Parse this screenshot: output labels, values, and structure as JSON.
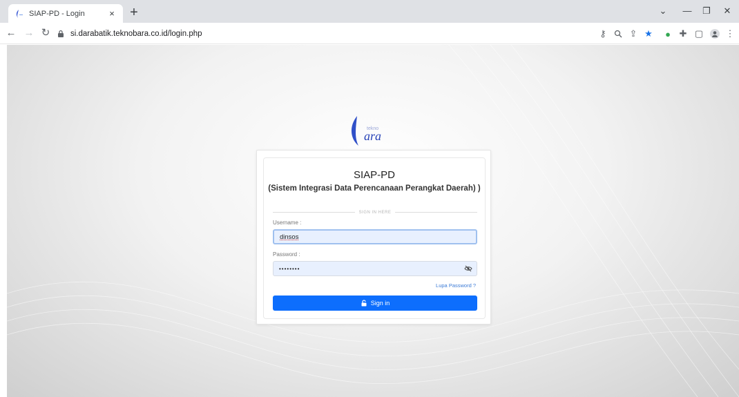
{
  "browser": {
    "tab_title": "SIAP-PD - Login",
    "tab_close": "×",
    "new_tab": "+",
    "url": "si.darabatik.teknobara.co.id/login.php",
    "window_controls": {
      "dropdown": "⌄",
      "minimize": "—",
      "restore": "❐",
      "close": "✕"
    }
  },
  "login": {
    "logo_text": "ara",
    "logo_small": "tekno",
    "title": "SIAP-PD",
    "subtitle": "(Sistem Integrasi Data Perencanaan Perangkat Daerah) )",
    "divider_text": "SIGN IN HERE",
    "username_label": "Username :",
    "username_value": "dinsos",
    "password_label": "Password :",
    "password_value": "••••••••",
    "forgot_password": "Lupa Password ?",
    "signin_label": "Sign in"
  },
  "colors": {
    "primary": "#0d6efd",
    "link": "#3c7bd6",
    "input_bg": "#e8f0fe"
  }
}
